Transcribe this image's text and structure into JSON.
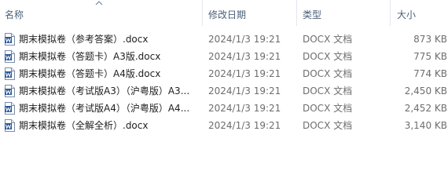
{
  "columns": {
    "name": "名称",
    "modified": "修改日期",
    "type": "类型",
    "size": "大小"
  },
  "files": [
    {
      "name": "期末模拟卷（参考答案）.docx",
      "modified": "2024/1/3 19:21",
      "type": "DOCX 文档",
      "size": "873 KB"
    },
    {
      "name": "期末模拟卷（答题卡）A3版.docx",
      "modified": "2024/1/3 19:21",
      "type": "DOCX 文档",
      "size": "775 KB"
    },
    {
      "name": "期末模拟卷（答题卡）A4版.docx",
      "modified": "2024/1/3 19:21",
      "type": "DOCX 文档",
      "size": "774 KB"
    },
    {
      "name": "期末模拟卷（考试版A3）（沪粤版）A3...",
      "modified": "2024/1/3 19:21",
      "type": "DOCX 文档",
      "size": "2,450 KB"
    },
    {
      "name": "期末模拟卷（考试版A4）（沪粤版）A4...",
      "modified": "2024/1/3 19:21",
      "type": "DOCX 文档",
      "size": "2,452 KB"
    },
    {
      "name": "期末模拟卷（全解全析）.docx",
      "modified": "2024/1/3 19:21",
      "type": "DOCX 文档",
      "size": "3,140 KB"
    }
  ],
  "icons": {
    "file": "word-doc-icon",
    "sort": "sort-ascending-icon"
  },
  "colors": {
    "header_text": "#4c607a",
    "word_blue": "#2b579a"
  }
}
